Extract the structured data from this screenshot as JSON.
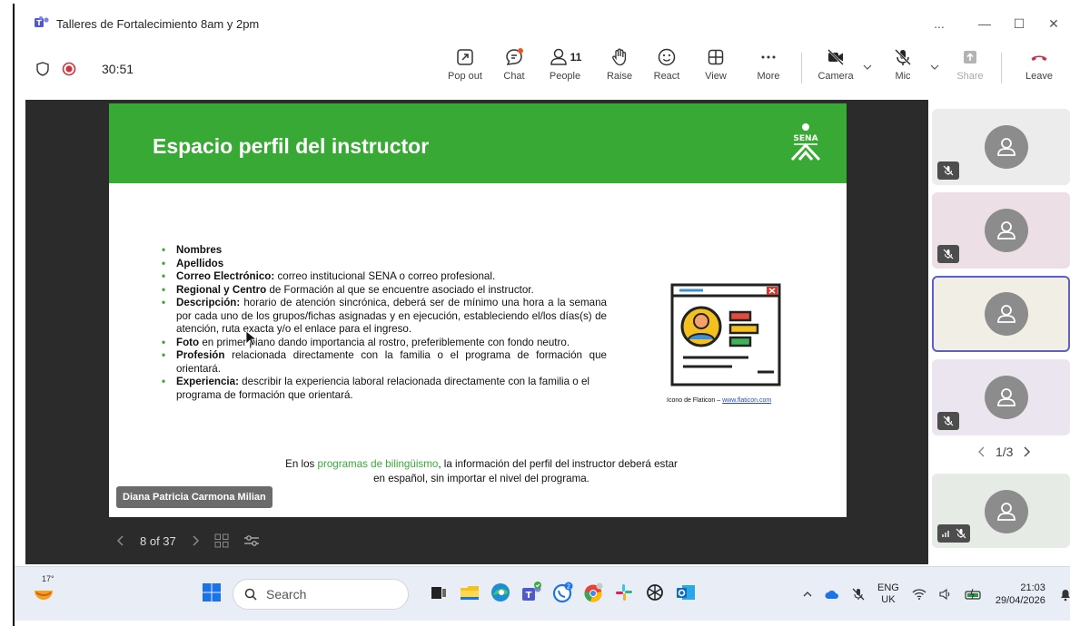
{
  "window": {
    "title": "Talleres de Fortalecimiento 8am y 2pm",
    "controls": [
      "...",
      "—",
      "☐",
      "✕"
    ]
  },
  "toolbar": {
    "timer": "30:51",
    "buttons": [
      {
        "label": "Pop out",
        "icon": "pop-out-icon"
      },
      {
        "label": "Chat",
        "icon": "chat-icon"
      },
      {
        "label": "People",
        "icon": "people-icon",
        "count": "11"
      },
      {
        "label": "Raise",
        "icon": "raise-hand-icon"
      },
      {
        "label": "React",
        "icon": "react-icon"
      },
      {
        "label": "View",
        "icon": "view-icon"
      },
      {
        "label": "More",
        "icon": "more-icon"
      },
      {
        "label": "Camera",
        "icon": "camera-off-icon"
      },
      {
        "label": "Mic",
        "icon": "mic-off-icon"
      },
      {
        "label": "Share",
        "icon": "share-icon"
      },
      {
        "label": "Leave",
        "icon": "leave-icon"
      }
    ],
    "colors": {
      "record": "#d13438",
      "leave": "#c4314b",
      "chat_dot": "#e8572b"
    }
  },
  "slide": {
    "title": "Espacio perfil del instructor",
    "header_color": "#39a935",
    "logo_text": "SENA",
    "items": [
      {
        "bold": "Nombres",
        "text": ""
      },
      {
        "bold": "Apellidos",
        "text": ""
      },
      {
        "bold": "Correo Electrónico:",
        "text": " correo institucional SENA o correo profesional."
      },
      {
        "bold": "Regional y Centro",
        "text": " de Formación al que se encuentre asociado el instructor."
      },
      {
        "bold": "Descripción:",
        "text": " horario de atención sincrónica, deberá ser de mínimo una hora a la semana por cada uno de los grupos/fichas asignadas y en ejecución, estableciendo el/los días(s) de atención, ruta exacta y/o el enlace para el ingreso."
      },
      {
        "bold": "Foto",
        "text": " en primer plano dando importancia al rostro, preferiblemente con fondo neutro."
      },
      {
        "bold": "Profesión",
        "text": " relacionada directamente con la familia o el programa de formación que orientará."
      },
      {
        "bold": "Experiencia:",
        "text": " describir la experiencia laboral relacionada directamente con la familia o el programa de formación que orientará."
      }
    ],
    "credit_text": "Icono de Flaticon – ",
    "credit_link": "www.flaticon.com",
    "footnote_pre": "En los ",
    "footnote_highlight": "programas de bilingüismo",
    "footnote_post": ", la información del perfil del instructor deberá estar en español, sin importar el nivel del programa.",
    "presenter": "Diana Patricia Carmona Milian"
  },
  "slide_nav": {
    "position": "8 of 37"
  },
  "participants": {
    "pager": "1/3",
    "tiles": [
      {
        "muted": true,
        "speaking": false,
        "selected": false,
        "bg": "#ececec"
      },
      {
        "muted": true,
        "speaking": false,
        "selected": false,
        "bg": "#ecdfe6"
      },
      {
        "muted": false,
        "speaking": false,
        "selected": true,
        "bg": "#f1eee6"
      },
      {
        "muted": true,
        "speaking": false,
        "selected": false,
        "bg": "#ebe5ef"
      },
      {
        "muted": true,
        "speaking": true,
        "selected": false,
        "bg": "#e6ebe6"
      }
    ]
  },
  "taskbar": {
    "weather_temp": "17°",
    "search_placeholder": "Search",
    "chat_badge": "2",
    "lang_top": "ENG",
    "lang_bottom": "UK",
    "time": "21:03",
    "date": "29/04/2026"
  }
}
